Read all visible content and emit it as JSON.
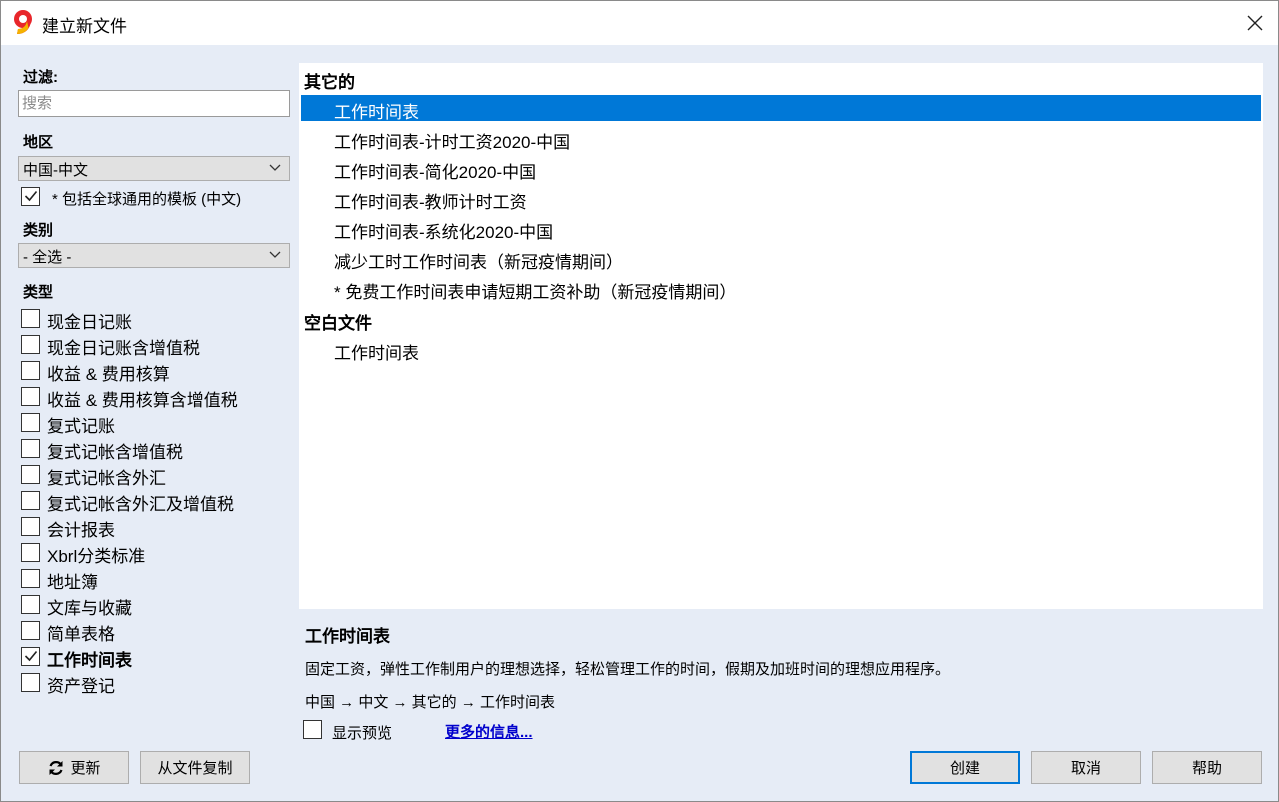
{
  "window": {
    "title": "建立新文件"
  },
  "filter": {
    "label": "过滤:",
    "search_placeholder": "搜索",
    "region_label": "地区",
    "region_value": "中国-中文",
    "global_templates_label": "* 包括全球通用的模板 (中文)",
    "global_templates_checked": true,
    "category_label": "类别",
    "category_value": "- 全选 -",
    "type_label": "类型"
  },
  "types": [
    {
      "label": "现金日记账",
      "checked": false
    },
    {
      "label": "现金日记账含增值税",
      "checked": false
    },
    {
      "label": "收益 & 费用核算",
      "checked": false
    },
    {
      "label": "收益 & 费用核算含增值税",
      "checked": false
    },
    {
      "label": "复式记账",
      "checked": false
    },
    {
      "label": "复式记帐含增值税",
      "checked": false
    },
    {
      "label": "复式记帐含外汇",
      "checked": false
    },
    {
      "label": "复式记帐含外汇及增值税",
      "checked": false
    },
    {
      "label": "会计报表",
      "checked": false
    },
    {
      "label": "Xbrl分类标准",
      "checked": false
    },
    {
      "label": "地址簿",
      "checked": false
    },
    {
      "label": "文库与收藏",
      "checked": false
    },
    {
      "label": "简单表格",
      "checked": false
    },
    {
      "label": "工作时间表",
      "checked": true
    },
    {
      "label": "资产登记",
      "checked": false
    }
  ],
  "templates": {
    "groups": [
      {
        "name": "其它的",
        "items": [
          "工作时间表",
          "工作时间表-计时工资2020-中国",
          "工作时间表-简化2020-中国",
          "工作时间表-教师计时工资",
          "工作时间表-系统化2020-中国",
          "减少工时工作时间表（新冠疫情期间）",
          "* 免费工作时间表申请短期工资补助（新冠疫情期间）"
        ]
      },
      {
        "name": "空白文件",
        "items": [
          "工作时间表"
        ]
      }
    ],
    "selected": "工作时间表"
  },
  "description": {
    "title": "工作时间表",
    "text": "固定工资，弹性工作制用户的理想选择，轻松管理工作的时间，假期及加班时间的理想应用程序。",
    "path": "中国 → 中文 → 其它的 → 工作时间表",
    "show_preview_label": "显示预览",
    "show_preview_checked": false,
    "more_info_label": "更多的信息..."
  },
  "buttons": {
    "update": "更新",
    "copy_from_file": "从文件复制",
    "create": "创建",
    "cancel": "取消",
    "help": "帮助"
  },
  "colors": {
    "selection": "#0078d7",
    "panel_bg": "#e6ecf6",
    "link": "#0000cc",
    "logo_red": "#e8262b",
    "logo_yellow": "#f5b300"
  }
}
